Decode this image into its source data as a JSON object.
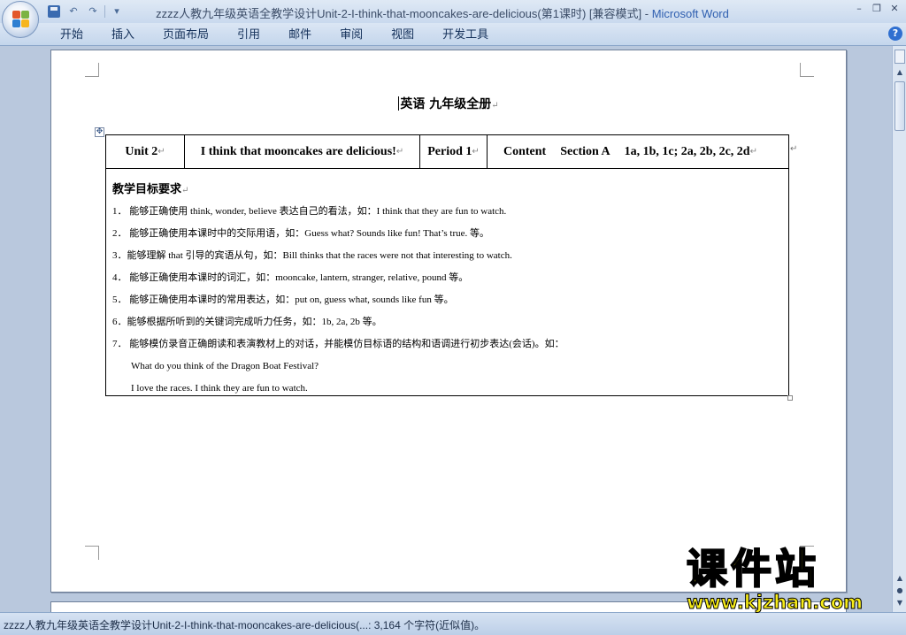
{
  "window": {
    "title_doc": "zzzz人教九年级英语全教学设计Unit-2-I-think-that-mooncakes-are-delicious(第1课时) [兼容模式]",
    "title_sep": " - ",
    "title_app": "Microsoft Word",
    "controls": {
      "minimize": "–",
      "restore": "❐",
      "close": "✕"
    }
  },
  "quick_access": {
    "undo": "↶",
    "redo": "↷",
    "more": "▾"
  },
  "ribbon": {
    "tabs": [
      "开始",
      "插入",
      "页面布局",
      "引用",
      "邮件",
      "审阅",
      "视图",
      "开发工具"
    ],
    "help": "?"
  },
  "document": {
    "heading": "英语  九年级全册",
    "para_mark": "↵",
    "header_row": {
      "unit": "Unit 2",
      "title": "I think that mooncakes are delicious!",
      "period": "Period 1",
      "content_label": "Content",
      "section": "Section A",
      "activities": "1a, 1b, 1c; 2a, 2b, 2c, 2d"
    },
    "goals_title": "教学目标要求",
    "goals": [
      "1．  能够正确使用 think, wonder, believe 表达自己的看法，如：I think that they are fun to watch.",
      "2．  能够正确使用本课时中的交际用语，如：Guess what? Sounds like fun! That’s true. 等。",
      "3．能够理解 that 引导的宾语从句，如：Bill thinks that the races were not that interesting to watch.",
      "4．  能够正确使用本课时的词汇，如：mooncake, lantern, stranger, relative, pound 等。",
      "5．  能够正确使用本课时的常用表达，如：put on, guess what, sounds like fun 等。",
      "6．能够根据所听到的关键词完成听力任务，如：1b, 2a, 2b 等。",
      "7．  能够模仿录音正确朗读和表演教材上的对话，并能模仿目标语的结构和语调进行初步表达(会话)。如："
    ],
    "examples": [
      "What do you think of the Dragon Boat Festival?",
      "I love the races. I think they are fun to watch."
    ]
  },
  "statusbar": {
    "text": "zzzz人教九年级英语全教学设计Unit-2-I-think-that-mooncakes-are-delicious(...: 3,164 个字符(近似值)。"
  },
  "watermark": {
    "cn": "课件站",
    "url": "www.kjzhan.com"
  },
  "colors": {
    "title_app": "#2f5fb0",
    "watermark": "#f7ec18",
    "workspace": "#b9c8dd"
  }
}
